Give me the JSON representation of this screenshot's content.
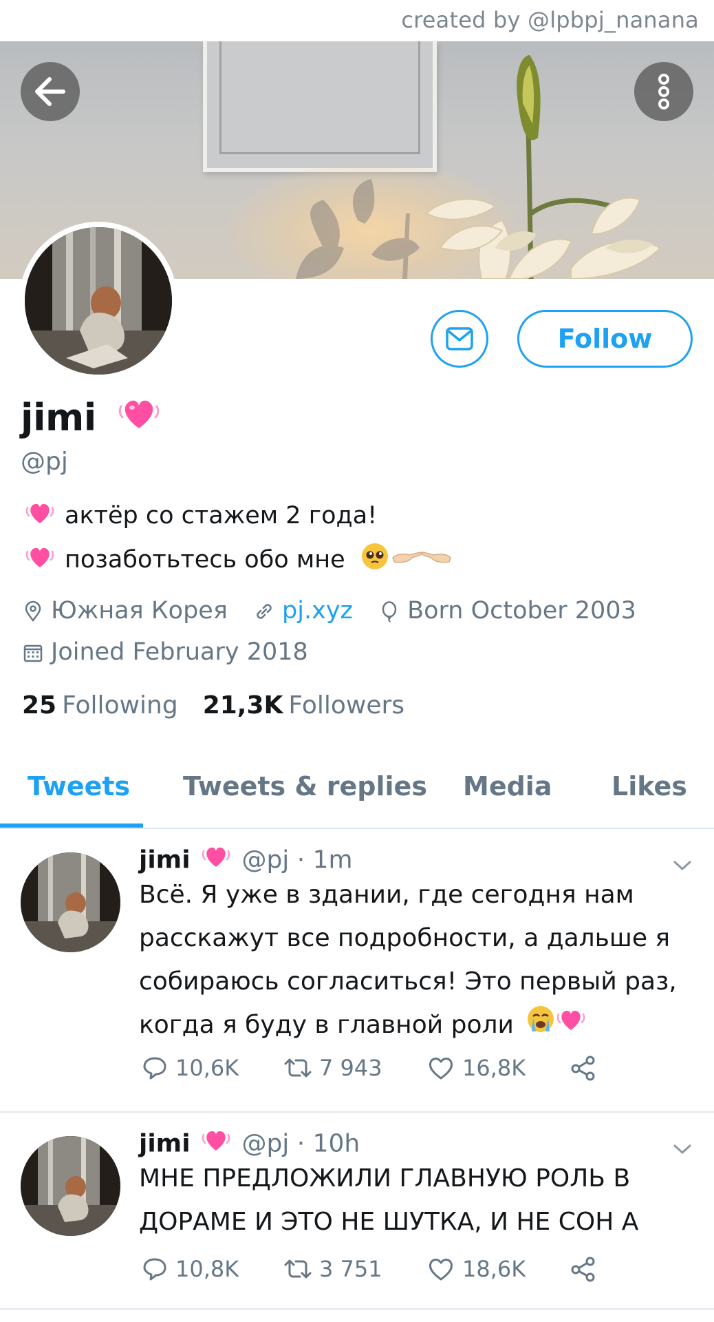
{
  "watermark": "created by @lpbpj_nanana",
  "header": {
    "back_icon": "arrow-left-icon",
    "more_icon": "more-vertical-icon"
  },
  "profile": {
    "name": "jimi",
    "handle": "@pj",
    "bio": [
      "актёр со стажем 2 года!",
      "позаботьтесь обо мне"
    ],
    "location": "Южная Корея",
    "website": "pj.xyz",
    "birthday": "Born October 2003",
    "joined": "Joined February 2018",
    "following_count": "25",
    "following_label": "Following",
    "followers_count": "21,3K",
    "followers_label": "Followers",
    "follow_label": "Follow",
    "message_icon": "envelope-icon"
  },
  "tabs": [
    {
      "label": "Tweets",
      "active": true
    },
    {
      "label": "Tweets & replies",
      "active": false
    },
    {
      "label": "Media",
      "active": false
    },
    {
      "label": "Likes",
      "active": false
    }
  ],
  "tweets": [
    {
      "name": "jimi",
      "handle_time": "@pj · 1m",
      "text": "Всё. Я уже в здании, где сегодня нам расскажут все подробности, а дальше я собираюсь согласиться! Это первый раз, когда я буду в главной роли",
      "replies": "10,6K",
      "retweets": "7 943",
      "likes": "16,8K"
    },
    {
      "name": "jimi",
      "handle_time": "@pj · 10h",
      "text": "МНЕ ПРЕДЛОЖИЛИ ГЛАВНУЮ РОЛЬ В ДОРАМЕ И ЭТО НЕ ШУТКА, И НЕ СОН А",
      "replies": "10,8K",
      "retweets": "3 751",
      "likes": "18,6K"
    }
  ],
  "colors": {
    "accent": "#1da1f2",
    "muted": "#657786",
    "heart": "#ff4fa3"
  }
}
